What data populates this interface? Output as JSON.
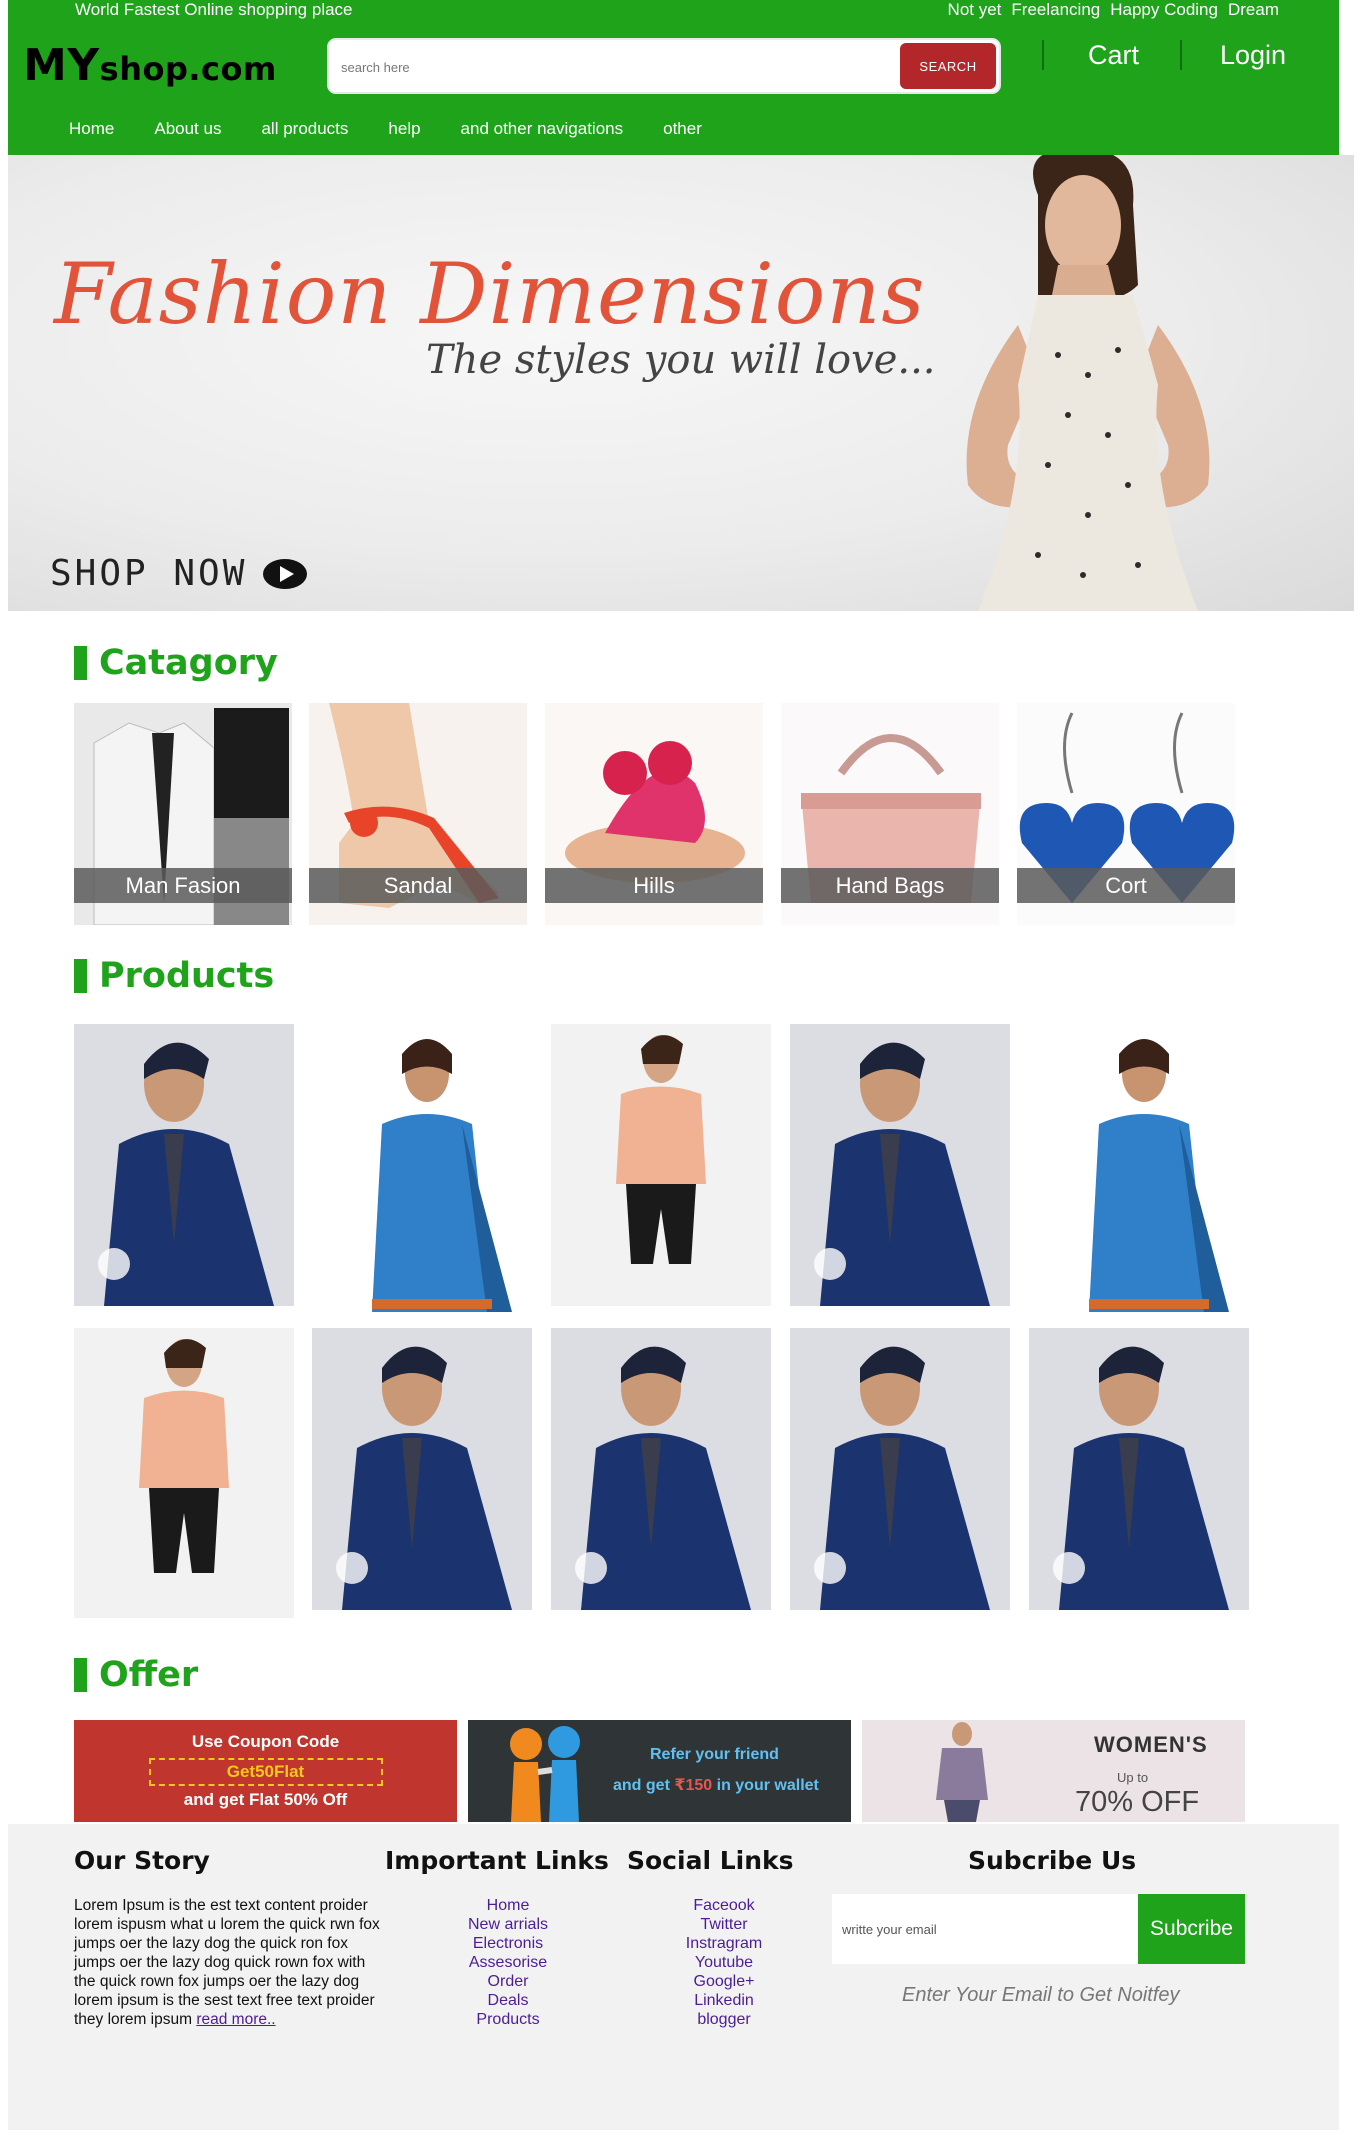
{
  "topbar": {
    "tagline": "World Fastest Online shopping place",
    "links": [
      "Not yet",
      "Freelancing",
      "Happy Coding",
      "Dream"
    ]
  },
  "header": {
    "logo_big": "MY",
    "logo_small": "shop.com",
    "search_placeholder": "search here",
    "search_button": "SEARCH",
    "cart": "Cart",
    "login": "Login",
    "nav": [
      "Home",
      "About us",
      "all products",
      "help",
      "and other navigations",
      "other"
    ]
  },
  "hero": {
    "title": "Fashion Dimensions",
    "subtitle": "The styles you will love...",
    "cta": "SHOP NOW"
  },
  "sections": {
    "category": "Catagory",
    "products": "Products",
    "offer": "Offer"
  },
  "categories": [
    "Man Fasion",
    "Sandal",
    "Hills",
    "Hand Bags",
    "Cort"
  ],
  "offers": {
    "coupon_line1": "Use Coupon Code",
    "coupon_code": "Get50Flat",
    "coupon_line3": "and get Flat 50% Off",
    "refer_line1": "Refer your friend",
    "refer_line2_pre": "and get ",
    "refer_amount": "₹150",
    "refer_line2_post": " in your wallet",
    "women_title": "WOMEN'S",
    "women_upto": "Up to",
    "women_off": "70% OFF"
  },
  "footer": {
    "story_title": "Our Story",
    "story_text": "Lorem Ipsum is the est text content proider lorem ispusm what u lorem the quick rwn fox jumps oer the lazy dog the quick ron fox jumps oer the lazy dog quick rown fox with the quick rown fox jumps oer the lazy dog lorem ipsum is the sest text free text proider they lorem ipsum ",
    "read_more": "read more..",
    "important_title": "Important Links",
    "important_links": [
      "Home",
      "New arrials",
      "Electronis",
      "Assesorise",
      "Order",
      "Deals",
      "Products"
    ],
    "social_title": "Social Links",
    "social_links": [
      "Faceook",
      "Twitter",
      "Instragram",
      "Youtube",
      "Google+",
      "Linkedin",
      "blogger"
    ],
    "subscribe_title": "Subcribe Us",
    "email_placeholder": "writte your email",
    "subscribe_button": "Subcribe",
    "subscribe_note": "Enter Your Email to Get Noitfey"
  },
  "colors": {
    "brand_green": "#1ea31b",
    "search_red": "#b3272a",
    "link_purple": "#4b1d97"
  }
}
